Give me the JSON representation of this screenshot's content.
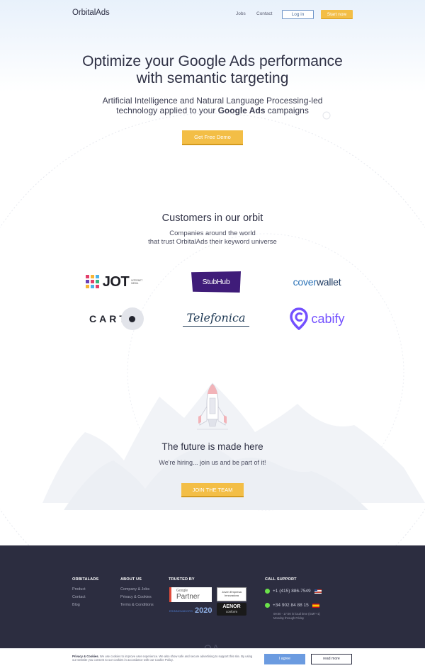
{
  "nav": {
    "logo": "OrbitalAds",
    "jobs": "Jobs",
    "contact": "Contact",
    "login": "Log in",
    "start": "Start now"
  },
  "hero": {
    "headline_line1": "Optimize your Google Ads performance",
    "headline_line2": "with semantic targeting",
    "sub_line1": "Artificial Intelligence and Natural Language Processing-led",
    "sub_line2_pre": "technology applied to your ",
    "sub_line2_bold": "Google Ads",
    "sub_line2_post": " campaigns",
    "cta": "Get Free Demo"
  },
  "customers": {
    "title": "Customers in our orbit",
    "sub_line1": "Companies around the world",
    "sub_line2": "that trust OrbitalAds their keyword universe",
    "logos": {
      "jot": "JOT",
      "jot_small": "INTERNET MEDIA",
      "stubhub": "StubHub",
      "coverwallet_a": "cover",
      "coverwallet_b": "wallet",
      "carto": "CART",
      "telefonica": "Telefonica",
      "cabify": "cabify"
    }
  },
  "future": {
    "title": "The future is made here",
    "sub": "We're hiring... join us and be part of it!",
    "cta": "JOIN THE TEAM"
  },
  "footer": {
    "col1_head": "ORBITALADS",
    "col1_links": [
      "Product",
      "Contact",
      "Blog"
    ],
    "col2_head": "ABOUT US",
    "col2_links": [
      "Company & Jobs",
      "Privacy & Cookies",
      "Terms & Conditions"
    ],
    "col3_head": "TRUSTED BY",
    "google_partner_small": "Google",
    "google_partner_big": "Partner",
    "joven_line1": "Joven Empresa",
    "joven_line2": "Innovadora",
    "aenor": "AENOR",
    "aenor_sub": "conform",
    "es_label": "ESINNOVADORS",
    "es_num": "2020",
    "col4_head": "CALL SUPPORT",
    "phone_us": "+1 (415) 886-7549",
    "phone_es": "+34 902 84 88 15",
    "hours_line1": "09:00 - 17:00 in local time (GMT+1)",
    "hours_line2": "Monday through Friday",
    "oa": "OA"
  },
  "cookie": {
    "bold": "Privacy & Cookies.",
    "text": " We use cookies to improve user experience. We also show safe and secure advertising to support this site. By using our website you consent to our cookies in accordance with our Cookie Policy.",
    "agree": "I agree",
    "read_more": "read more"
  }
}
